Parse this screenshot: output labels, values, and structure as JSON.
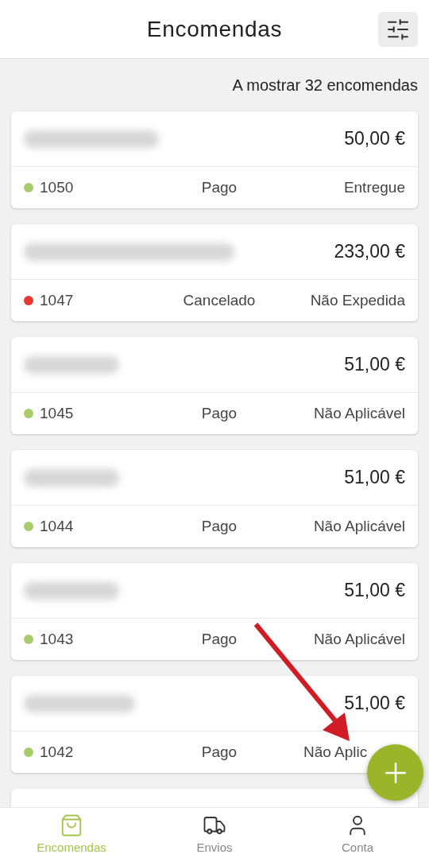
{
  "header": {
    "title": "Encomendas"
  },
  "count_text": "A mostrar 32 encomendas",
  "orders": [
    {
      "amount": "50,00 €",
      "number": "1050",
      "payment": "Pago",
      "shipping": "Entregue",
      "color": "#a8cc6a"
    },
    {
      "amount": "233,00 €",
      "number": "1047",
      "payment": "Cancelado",
      "shipping": "Não Expedida",
      "color": "#e53935"
    },
    {
      "amount": "51,00 €",
      "number": "1045",
      "payment": "Pago",
      "shipping": "Não Aplicável",
      "color": "#a8cc6a"
    },
    {
      "amount": "51,00 €",
      "number": "1044",
      "payment": "Pago",
      "shipping": "Não Aplicável",
      "color": "#a8cc6a"
    },
    {
      "amount": "51,00 €",
      "number": "1043",
      "payment": "Pago",
      "shipping": "Não Aplicável",
      "color": "#a8cc6a"
    },
    {
      "amount": "51,00 €",
      "number": "1042",
      "payment": "Pago",
      "shipping": "Não Aplic",
      "shipping_cut": true,
      "color": "#a8cc6a"
    }
  ],
  "nav": [
    {
      "kind": "bag",
      "label": "Encomendas",
      "selected": true
    },
    {
      "kind": "truck",
      "label": "Envios",
      "selected": false
    },
    {
      "kind": "user",
      "label": "Conta",
      "selected": false
    }
  ]
}
